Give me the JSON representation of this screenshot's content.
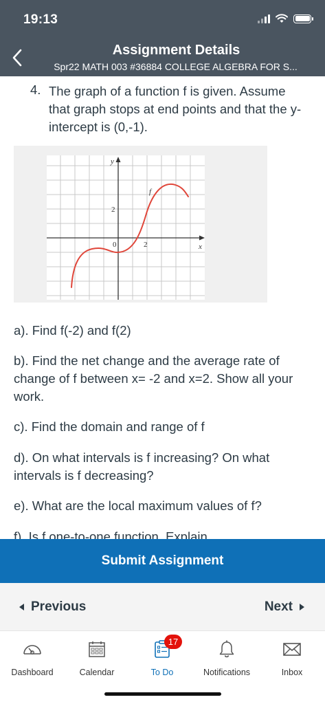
{
  "status_bar": {
    "time": "19:13"
  },
  "header": {
    "title": "Assignment Details",
    "subtitle": "Spr22 MATH 003 #36884 COLLEGE ALGEBRA FOR S..."
  },
  "question": {
    "number": "4.",
    "text": "The graph of a  function f is given. Assume that graph stops at end points and that the y-intercept is (0,-1).",
    "graph": {
      "y_axis_label": "y",
      "x_axis_label": "x",
      "function_label": "f",
      "tick_y": "2",
      "tick_origin": "0",
      "tick_x": "2",
      "curve_color": "#e0463a"
    },
    "parts": [
      "a). Find f(-2) and f(2)",
      "b). Find the net change and the average rate of change of f between x= -2 and x=2.  Show all your work.",
      "c). Find the domain and range of f",
      "d). On what intervals is f increasing? On what intervals is f decreasing?",
      "e). What are the local maximum values of f?",
      "f). Is f one-to-one function.  Explain"
    ]
  },
  "submit": {
    "label": "Submit Assignment"
  },
  "pager": {
    "previous": "Previous",
    "next": "Next"
  },
  "tabbar": {
    "items": [
      {
        "label": "Dashboard",
        "icon": "dashboard-icon"
      },
      {
        "label": "Calendar",
        "icon": "calendar-icon"
      },
      {
        "label": "To Do",
        "icon": "todo-icon",
        "badge": "17"
      },
      {
        "label": "Notifications",
        "icon": "bell-icon"
      },
      {
        "label": "Inbox",
        "icon": "inbox-icon"
      }
    ]
  },
  "colors": {
    "header": "#4a5560",
    "accent": "#0f70b7",
    "badge": "#e3120b"
  }
}
